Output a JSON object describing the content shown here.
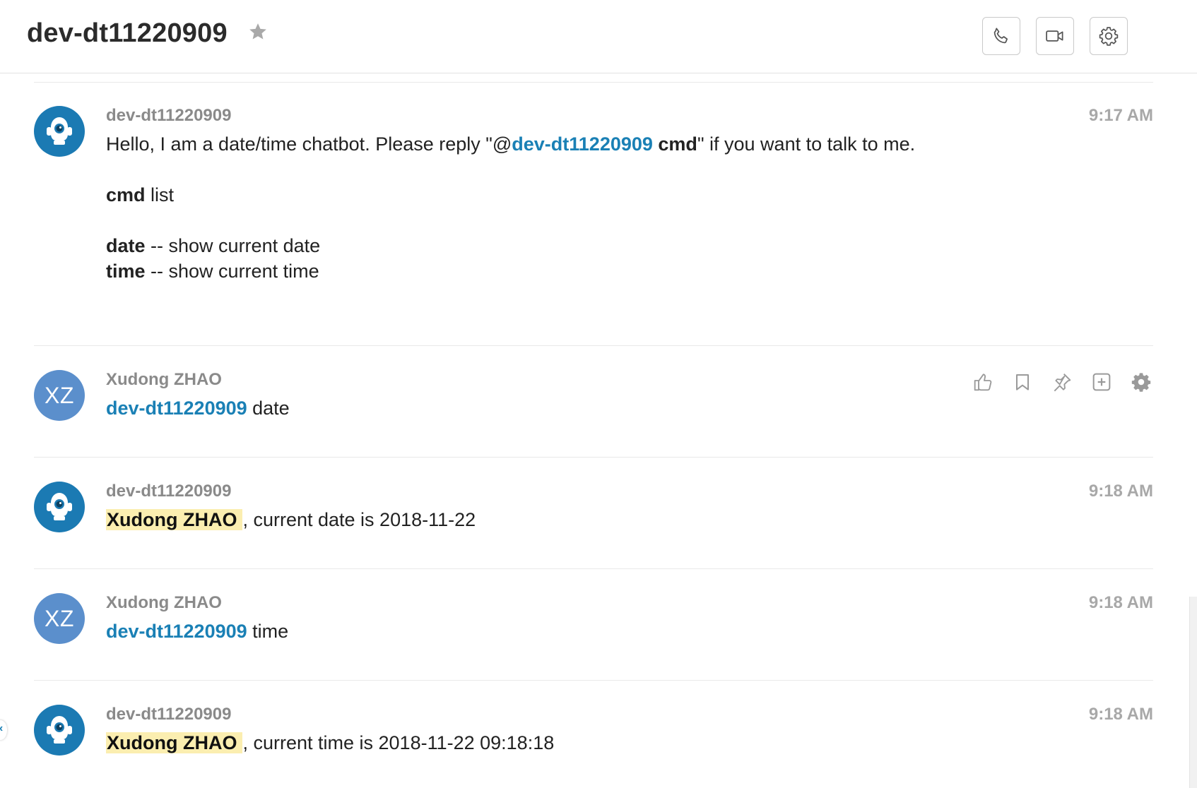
{
  "header": {
    "title": "dev-dt11220909",
    "star_icon": "star-icon",
    "buttons": [
      {
        "name": "call-button",
        "icon": "phone-icon"
      },
      {
        "name": "video-button",
        "icon": "video-camera-icon"
      },
      {
        "name": "settings-button",
        "icon": "gear-icon"
      }
    ]
  },
  "colors": {
    "mention": "#1a80b5",
    "highlight": "#fbeeb0",
    "bot_avatar": "#1b7ab3",
    "user_avatar": "#5b8fcc"
  },
  "messages": [
    {
      "sender": "dev-dt11220909",
      "time": "9:17 AM",
      "avatar": "robot-icon",
      "intro_text_1": "Hello, I am a date/time chatbot. Please reply \"@",
      "intro_mention": "dev-dt11220909",
      "intro_cmd": " cmd",
      "intro_text_2": "\" if you want to talk to me.",
      "cmd_label": "cmd",
      "cmd_text": " list",
      "commands": [
        {
          "name": "date",
          "desc": " -- show current date"
        },
        {
          "name": "time",
          "desc": " -- show current time"
        }
      ]
    },
    {
      "sender": "Xudong ZHAO",
      "avatar_initials": "XZ",
      "mention": "dev-dt11220909",
      "text": " date",
      "actions": [
        "thumbs-up-icon",
        "bookmark-icon",
        "pin-icon",
        "add-box-icon",
        "gear-icon"
      ]
    },
    {
      "sender": "dev-dt11220909",
      "time": "9:18 AM",
      "avatar": "robot-icon",
      "highlight": "Xudong ZHAO",
      "text": ", current date is 2018-11-22"
    },
    {
      "sender": "Xudong ZHAO",
      "time": "9:18 AM",
      "avatar_initials": "XZ",
      "mention": "dev-dt11220909",
      "text": " time"
    },
    {
      "sender": "dev-dt11220909",
      "time": "9:18 AM",
      "avatar": "robot-icon",
      "highlight": "Xudong ZHAO",
      "text": ", current time is 2018-11-22 09:18:18"
    }
  ]
}
